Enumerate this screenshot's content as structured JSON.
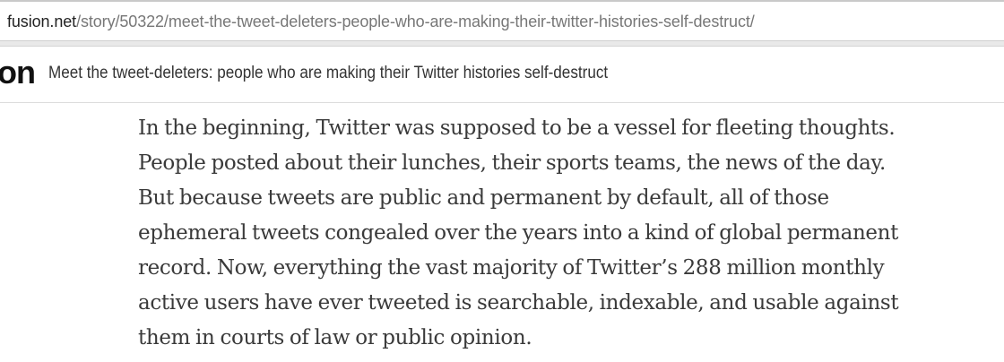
{
  "browser": {
    "url_host": "fusion.net",
    "url_path": "/story/50322/meet-the-tweet-deleters-people-who-are-making-their-twitter-histories-self-destruct/"
  },
  "header": {
    "logo_text": "on",
    "title": "Meet the tweet-deleters: people who are making their Twitter histories self-destruct"
  },
  "article": {
    "lines": [
      "In the beginning, Twitter was supposed to be a vessel for fleeting thoughts.",
      "People posted about their lunches, their sports teams, the news of the day.",
      "But because tweets are public and permanent by default, all of those",
      "ephemeral tweets congealed over the years into a kind of global permanent",
      "record. Now, everything the vast majority of Twitter’s 288 million monthly",
      "active users have ever tweeted is searchable, indexable, and usable against",
      "them in courts of law or public opinion."
    ]
  }
}
